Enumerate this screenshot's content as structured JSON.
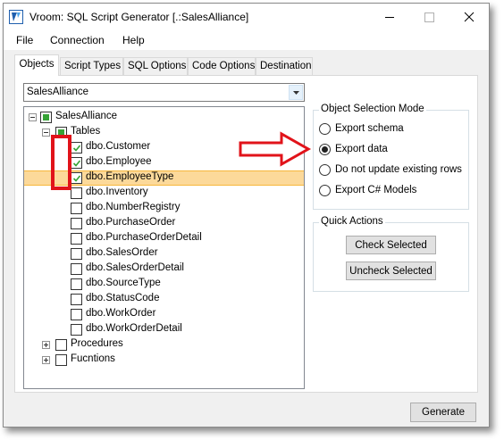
{
  "window": {
    "title": "Vroom: SQL Script Generator [.:SalesAlliance]",
    "controls": {
      "minimize_icon": "minimize-icon",
      "maximize_icon": "maximize-icon",
      "close_icon": "close-icon"
    }
  },
  "menu": [
    "File",
    "Connection",
    "Help"
  ],
  "tabs": [
    {
      "label": "Objects",
      "active": true
    },
    {
      "label": "Script Types",
      "active": false
    },
    {
      "label": "SQL Options",
      "active": false
    },
    {
      "label": "Code Options",
      "active": false
    },
    {
      "label": "Destination",
      "active": false
    }
  ],
  "database_select": {
    "value": "SalesAlliance"
  },
  "tree": {
    "root": {
      "label": "SalesAlliance",
      "state": "partial",
      "expanded": true
    },
    "tables": {
      "label": "Tables",
      "state": "partial",
      "expanded": true
    },
    "table_items": [
      {
        "label": "dbo.Customer",
        "checked": true,
        "selected": false
      },
      {
        "label": "dbo.Employee",
        "checked": true,
        "selected": false
      },
      {
        "label": "dbo.EmployeeType",
        "checked": true,
        "selected": true
      },
      {
        "label": "dbo.Inventory",
        "checked": false,
        "selected": false
      },
      {
        "label": "dbo.NumberRegistry",
        "checked": false,
        "selected": false
      },
      {
        "label": "dbo.PurchaseOrder",
        "checked": false,
        "selected": false
      },
      {
        "label": "dbo.PurchaseOrderDetail",
        "checked": false,
        "selected": false
      },
      {
        "label": "dbo.SalesOrder",
        "checked": false,
        "selected": false
      },
      {
        "label": "dbo.SalesOrderDetail",
        "checked": false,
        "selected": false
      },
      {
        "label": "dbo.SourceType",
        "checked": false,
        "selected": false
      },
      {
        "label": "dbo.StatusCode",
        "checked": false,
        "selected": false
      },
      {
        "label": "dbo.WorkOrder",
        "checked": false,
        "selected": false
      },
      {
        "label": "dbo.WorkOrderDetail",
        "checked": false,
        "selected": false
      }
    ],
    "procedures": {
      "label": "Procedures",
      "state": "unchecked",
      "expanded": false
    },
    "functions": {
      "label": "Fucntions",
      "state": "unchecked",
      "expanded": false
    }
  },
  "selection_mode": {
    "title": "Object Selection Mode",
    "options": [
      {
        "label": "Export schema",
        "selected": false
      },
      {
        "label": "Export data",
        "selected": true
      },
      {
        "label": "Do not update existing rows",
        "selected": false
      },
      {
        "label": "Export C# Models",
        "selected": false
      }
    ]
  },
  "quick_actions": {
    "title": "Quick Actions",
    "check_selected": "Check Selected",
    "uncheck_selected": "Uncheck Selected"
  },
  "generate_button": "Generate",
  "colors": {
    "annotation_red": "#e1131a",
    "selection_highlight": "#fcd99a",
    "partial_check_green": "#35a335"
  }
}
